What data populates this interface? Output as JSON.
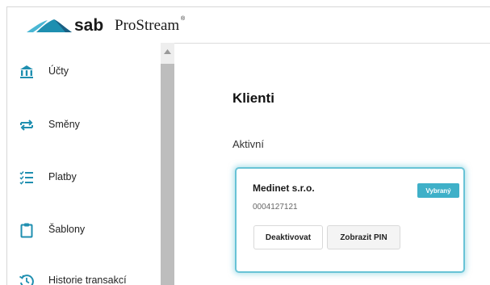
{
  "header": {
    "brand_name": "sab",
    "product_name": "ProStream",
    "registered_mark": "®",
    "logo_icon": "sab-wave-logo",
    "logo_colors": [
      "#1e8fb0",
      "#4ab7d4",
      "#1a5f83"
    ]
  },
  "sidebar": {
    "items": [
      {
        "label": "Účty",
        "icon": "bank-icon"
      },
      {
        "label": "Směny",
        "icon": "exchange-arrows-icon"
      },
      {
        "label": "Platby",
        "icon": "checklist-icon"
      },
      {
        "label": "Šablony",
        "icon": "clipboard-icon"
      },
      {
        "label": "Historie transakcí",
        "icon": "history-icon"
      }
    ],
    "scroll_up_icon": "scroll-up-arrow-icon"
  },
  "main": {
    "title": "Klienti",
    "section_label": "Aktivní",
    "client": {
      "name": "Medinet s.r.o.",
      "id": "0004127121",
      "badge": "Vybraný",
      "buttons": {
        "deactivate": "Deaktivovat",
        "show_pin": "Zobrazit PIN"
      }
    }
  },
  "colors": {
    "accent": "#3fb0c8",
    "card_border": "#68c3d6",
    "icon_color": "#1f8fb0"
  }
}
